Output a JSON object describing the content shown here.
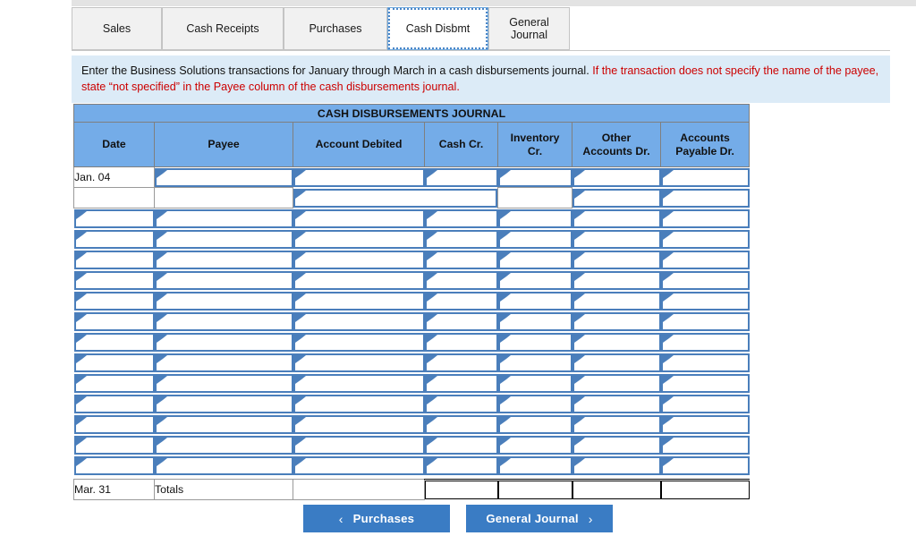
{
  "tabs": [
    {
      "label": "Sales",
      "active": false
    },
    {
      "label": "Cash Receipts",
      "active": false
    },
    {
      "label": "Purchases",
      "active": false
    },
    {
      "label": "Cash Disbmt",
      "active": true
    },
    {
      "label": "General\nJournal",
      "active": false
    }
  ],
  "instructions": {
    "black_part": "Enter the Business Solutions transactions for January through March in a cash disbursements journal. ",
    "red_part": "If the transaction does not specify the name of the payee, state “not specified” in the Payee column of the cash disbursements journal."
  },
  "journal": {
    "title": "CASH DISBURSEMENTS JOURNAL",
    "columns": [
      "Date",
      "Payee",
      "Account Debited",
      "Cash Cr.",
      "Inventory\nCr.",
      "Other\nAccounts Dr.",
      "Accounts\nPayable Dr."
    ],
    "first_row_date": "Jan. 04",
    "totals_date": "Mar. 31",
    "totals_label": "Totals",
    "editable_row_count": 13
  },
  "footer": {
    "prev_label": "Purchases",
    "prev_chevron": "‹",
    "next_label": "General Journal",
    "next_chevron": "›"
  },
  "colors": {
    "header_blue": "#74ace8",
    "banner_blue": "#dcebf7",
    "input_border": "#4a7ebb",
    "button_blue": "#3a7cc4",
    "instruction_red": "#cc0000"
  }
}
